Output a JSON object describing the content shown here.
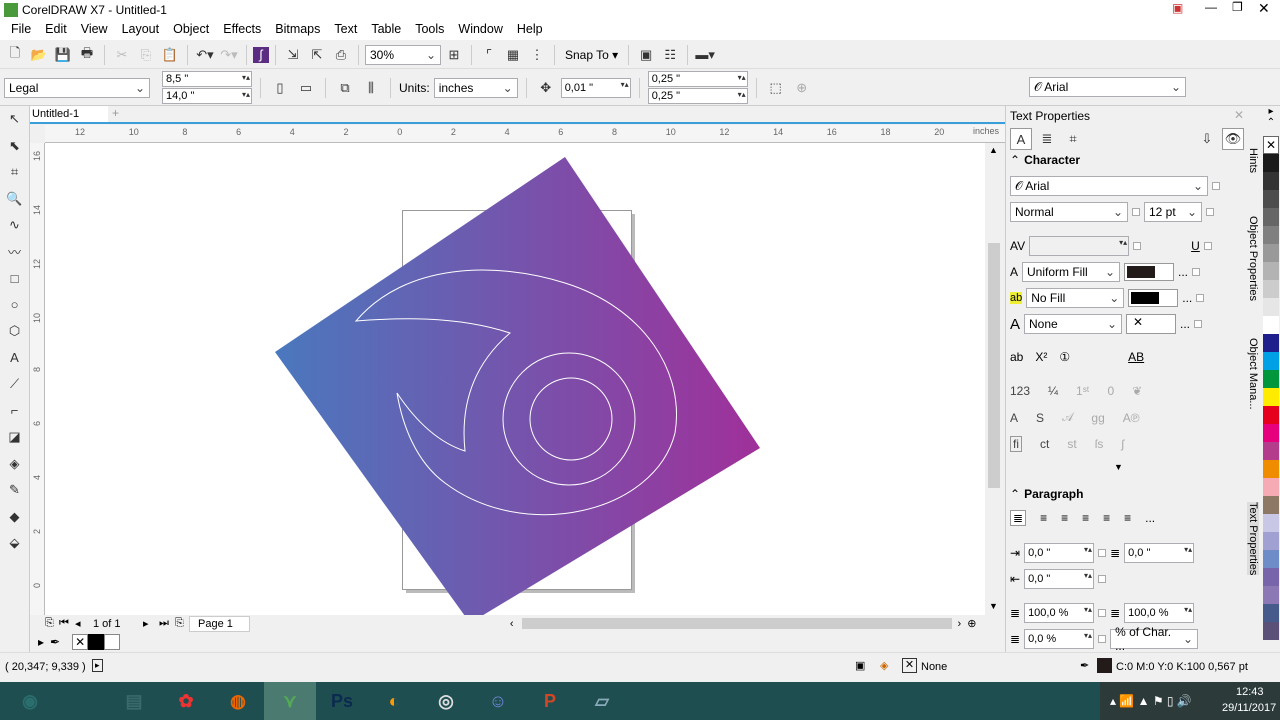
{
  "title": "CorelDRAW X7 - Untitled-1",
  "menu": [
    "File",
    "Edit",
    "View",
    "Layout",
    "Object",
    "Effects",
    "Bitmaps",
    "Text",
    "Table",
    "Tools",
    "Window",
    "Help"
  ],
  "toolbar": {
    "zoom": "30%",
    "snap_to": "Snap To"
  },
  "property_bar": {
    "page_size": "Legal",
    "width": "8,5 \"",
    "height": "14,0 \"",
    "units_label": "Units:",
    "units": "inches",
    "nudge": "0,01 \"",
    "dup_x": "0,25 \"",
    "dup_y": "0,25 \""
  },
  "font_box": "Arial",
  "document_tab": "Untitled-1",
  "ruler": {
    "h_ticks": [
      "12",
      "10",
      "8",
      "6",
      "4",
      "2",
      "0",
      "2",
      "4",
      "6",
      "8",
      "10",
      "12",
      "14",
      "16",
      "18",
      "20"
    ],
    "v_ticks": [
      "16",
      "14",
      "12",
      "10",
      "8",
      "6",
      "4",
      "2",
      "0"
    ],
    "unit": "inches"
  },
  "drawing": {
    "gradient_start": "#4a78be",
    "gradient_end": "#a0309a"
  },
  "page_nav": {
    "counter": "1 of 1",
    "page_tab": "Page 1"
  },
  "status": {
    "coords": "( 20,347; 9,339 )",
    "fill": "None",
    "outline": "C:0 M:0 Y:0 K:100  0,567 pt"
  },
  "panel": {
    "title": "Text Properties",
    "character": {
      "header": "Character",
      "font": "Arial",
      "style": "Normal",
      "size": "12 pt",
      "fill_type": "Uniform Fill",
      "fill_color": "#231a1a",
      "bg_fill": "No Fill",
      "bg_color": "#000000",
      "outline": "None",
      "more": "..."
    },
    "paragraph": {
      "header": "Paragraph",
      "indent_left": "0,0 \"",
      "indent_first": "0,0 \"",
      "indent_right": "0,0 \"",
      "line_spacing": "100,0 %",
      "char_spacing": "100,0 %",
      "before": "0,0 %",
      "units": "% of Char. ..."
    }
  },
  "dockers": [
    "Hints",
    "Object Properties",
    "Object Mana...",
    "Text Properties"
  ],
  "palette": [
    "#1a1a1a",
    "#333333",
    "#4d4d4d",
    "#666666",
    "#808080",
    "#999999",
    "#b3b3b3",
    "#cccccc",
    "#e6e6e6",
    "#ffffff",
    "#1e1e8c",
    "#00a0e6",
    "#00963c",
    "#ffeb00",
    "#e6001e",
    "#e6007e",
    "#b43c8c",
    "#f08c00",
    "#f5aab4",
    "#8c7864",
    "#c8c8e6",
    "#a0a0d2",
    "#6e8cc8",
    "#7864aa",
    "#8c78b4",
    "#465a8c",
    "#5a5078"
  ],
  "taskbar": {
    "apps": [
      "start",
      "Internet Explorer",
      "File Explorer",
      "Baidu",
      "Firefox",
      "CorelDRAW",
      "Photoshop",
      "UC Browser",
      "Chrome",
      "Discord",
      "PowerPoint",
      "Notes"
    ],
    "time": "12:43",
    "date": "29/11/2017"
  }
}
